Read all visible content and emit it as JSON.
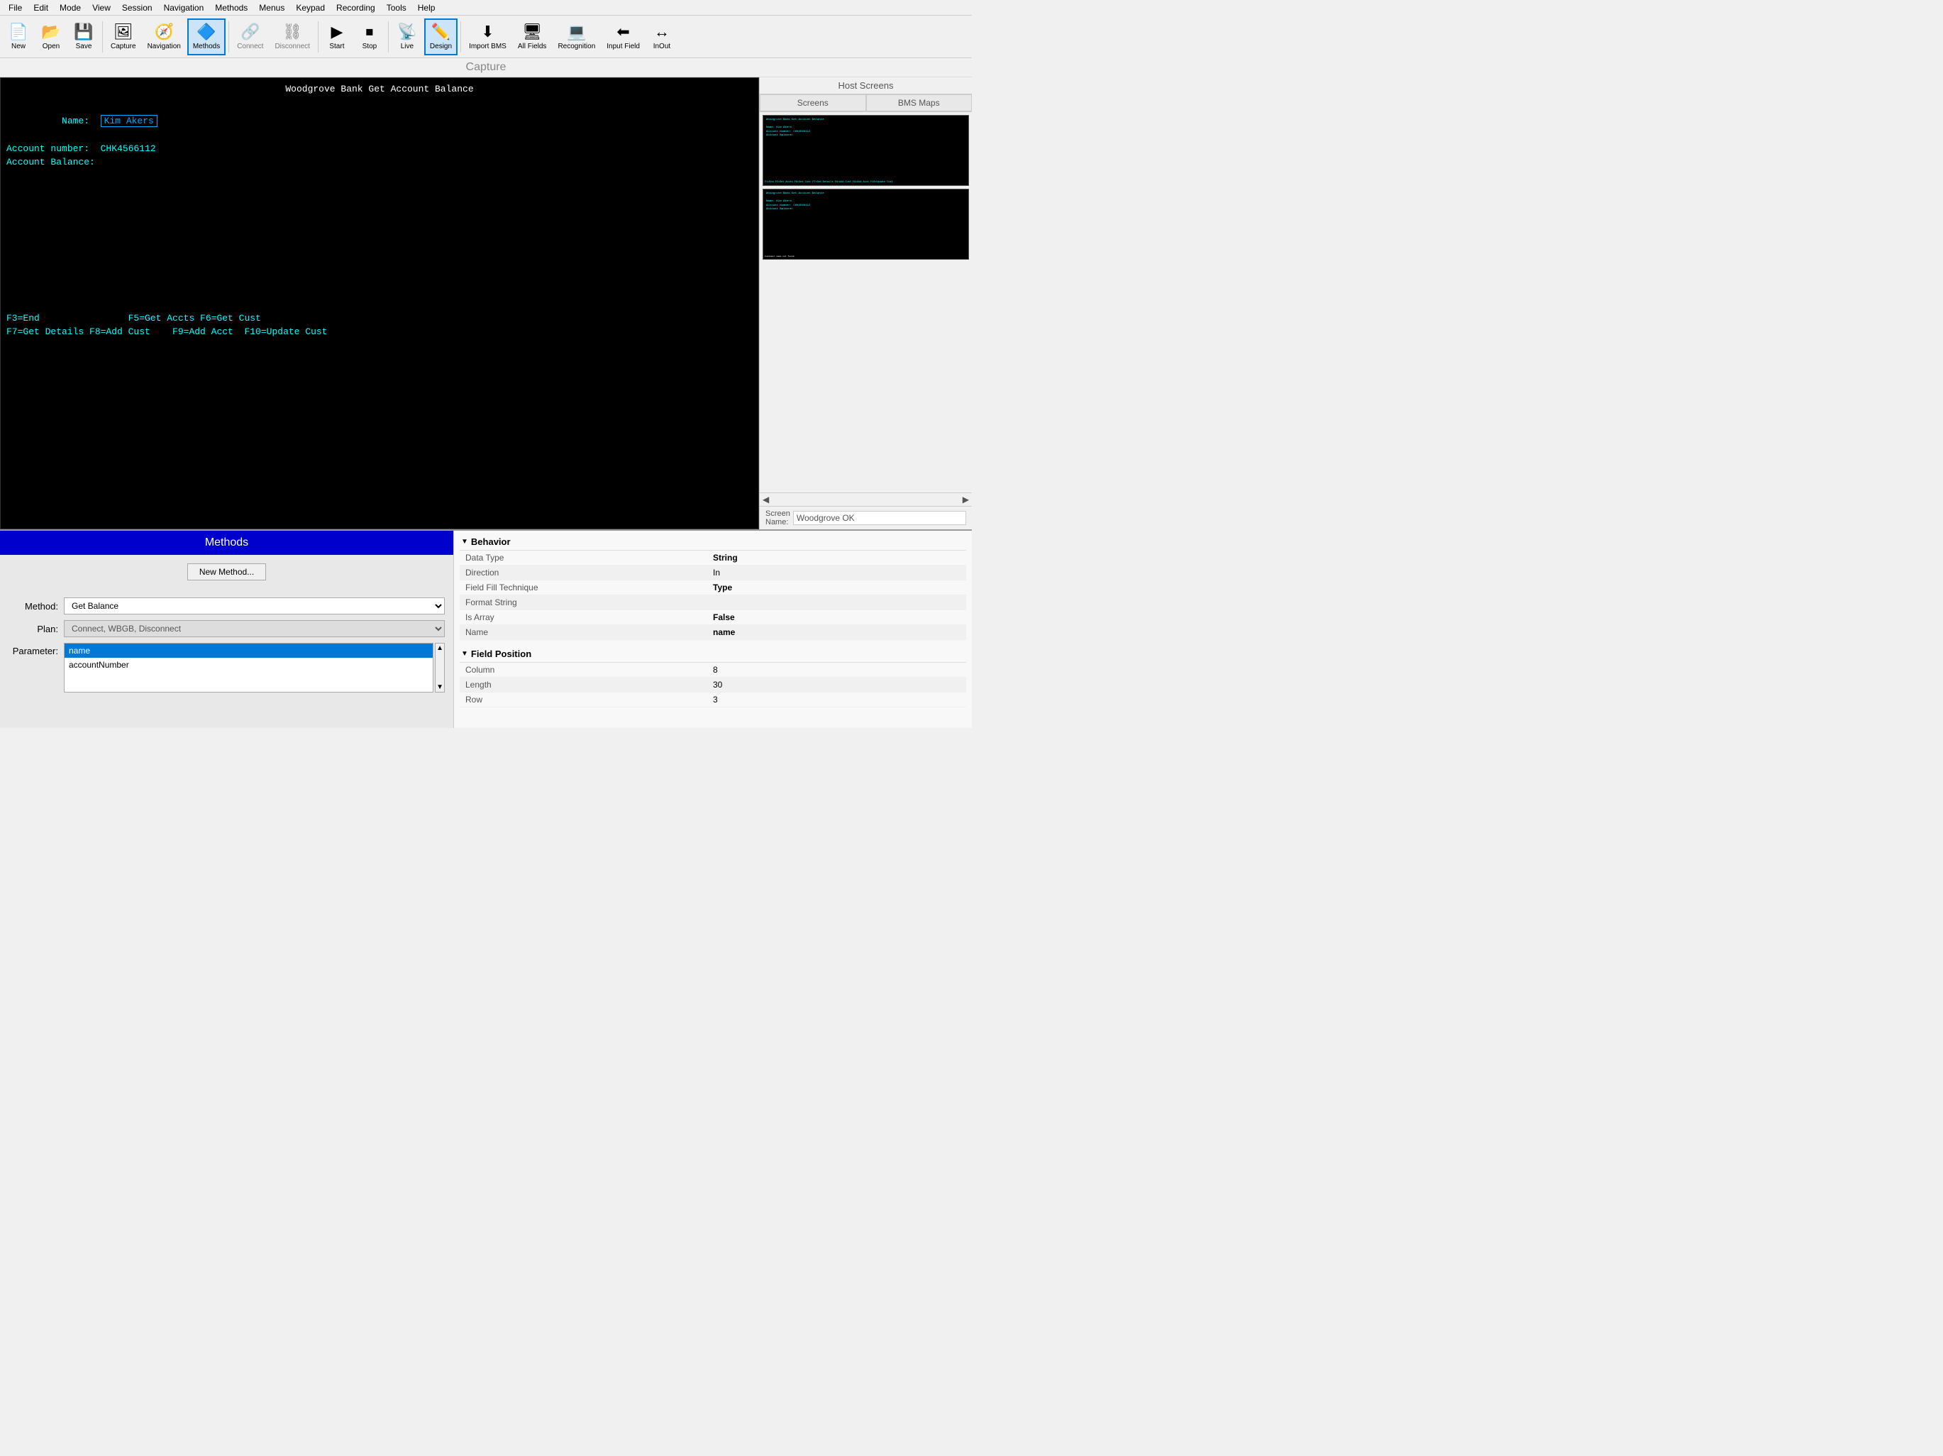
{
  "menubar": {
    "items": [
      "File",
      "Edit",
      "Mode",
      "View",
      "Session",
      "Navigation",
      "Methods",
      "Menus",
      "Keypad",
      "Recording",
      "Tools",
      "Help"
    ]
  },
  "toolbar": {
    "buttons": [
      {
        "id": "new",
        "label": "New",
        "icon": "📄"
      },
      {
        "id": "open",
        "label": "Open",
        "icon": "📂"
      },
      {
        "id": "save",
        "label": "Save",
        "icon": "💾"
      },
      {
        "id": "capture",
        "label": "Capture",
        "icon": "🖼"
      },
      {
        "id": "navigation",
        "label": "Navigation",
        "icon": "🧭"
      },
      {
        "id": "methods",
        "label": "Methods",
        "icon": "🔷",
        "active": true
      },
      {
        "id": "connect",
        "label": "Connect",
        "icon": "🔌",
        "disabled": true
      },
      {
        "id": "disconnect",
        "label": "Disconnect",
        "icon": "🔌",
        "disabled": true
      },
      {
        "id": "start",
        "label": "Start",
        "icon": "▶"
      },
      {
        "id": "stop",
        "label": "Stop",
        "icon": "⏹"
      },
      {
        "id": "live",
        "label": "Live",
        "icon": "📡"
      },
      {
        "id": "design",
        "label": "Design",
        "icon": "✏️",
        "active": true
      },
      {
        "id": "import-bms",
        "label": "Import BMS",
        "icon": "⬇"
      },
      {
        "id": "all-fields",
        "label": "All Fields",
        "icon": "🖥"
      },
      {
        "id": "recognition",
        "label": "Recognition",
        "icon": "💻"
      },
      {
        "id": "input-field",
        "label": "Input Field",
        "icon": "⬅"
      },
      {
        "id": "inout",
        "label": "InOut",
        "icon": "↔"
      }
    ]
  },
  "capture": {
    "header": "Capture"
  },
  "terminal": {
    "title": "Woodgrove Bank Get Account Balance",
    "lines": [
      {
        "text": "Name:  Kim Akers",
        "hasBox": true,
        "boxText": "Kim Akers"
      },
      {
        "text": "Account number:  CHK4566112"
      },
      {
        "text": "Account Balance:"
      }
    ],
    "bottom_lines": [
      "F3=End                F5=Get Accts F6=Get Cust",
      "F7=Get Details F8=Add Cust    F9=Add Acct  F10=Update Cust"
    ]
  },
  "host_screens": {
    "header": "Host Screens",
    "tabs": [
      "Screens",
      "BMS Maps"
    ],
    "screen_name_label": "Screen\nName:",
    "screen_name_value": "Woodgrove OK"
  },
  "methods": {
    "header": "Methods",
    "new_method_btn": "New Method...",
    "method_label": "Method:",
    "method_value": "Get Balance",
    "plan_label": "Plan:",
    "plan_value": "Connect, WBGB, Disconnect",
    "parameter_label": "Parameter:",
    "parameters": [
      {
        "id": "name",
        "label": "name",
        "selected": true
      },
      {
        "id": "accountNumber",
        "label": "accountNumber",
        "selected": false
      }
    ]
  },
  "properties": {
    "behavior_header": "Behavior",
    "behavior_rows": [
      {
        "key": "Data Type",
        "value": "String",
        "bold": true
      },
      {
        "key": "Direction",
        "value": "In",
        "bold": false
      },
      {
        "key": "Field Fill Technique",
        "value": "Type",
        "bold": true
      },
      {
        "key": "Format String",
        "value": "",
        "bold": false
      },
      {
        "key": "Is Array",
        "value": "False",
        "bold": true
      },
      {
        "key": "Name",
        "value": "name",
        "bold": true
      }
    ],
    "field_position_header": "Field Position",
    "field_position_rows": [
      {
        "key": "Column",
        "value": "8",
        "bold": false
      },
      {
        "key": "Length",
        "value": "30",
        "bold": false
      },
      {
        "key": "Row",
        "value": "3",
        "bold": false
      }
    ]
  }
}
